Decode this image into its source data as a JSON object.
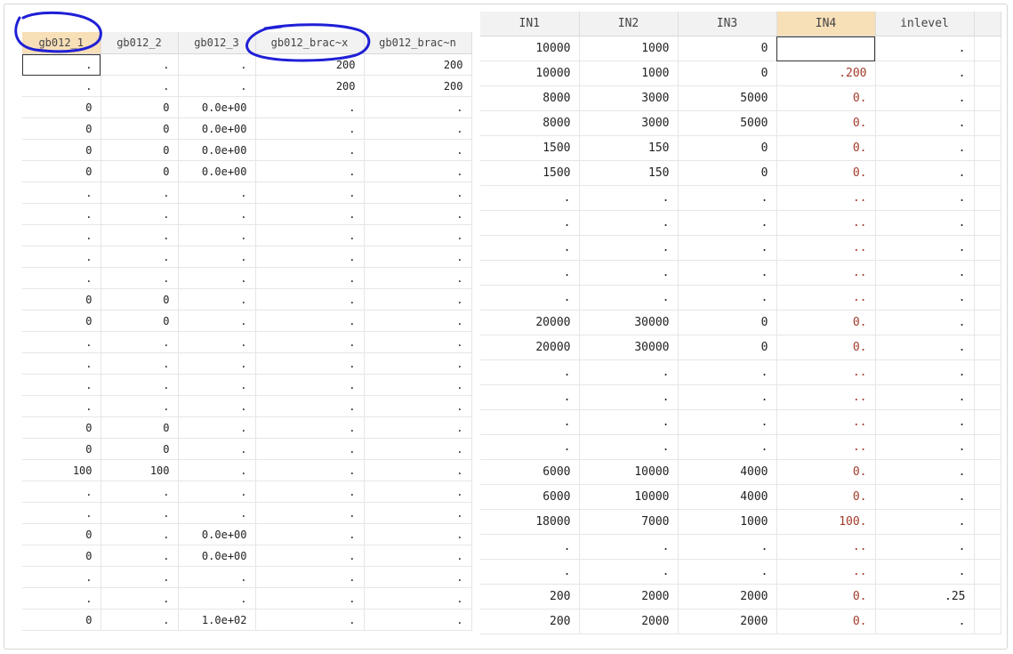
{
  "left_table": {
    "columns": [
      "gb012_1",
      "gb012_2",
      "gb012_3",
      "gb012_brac~x",
      "gb012_brac~n"
    ],
    "selected_column": 0,
    "rows": [
      [
        ".",
        ".",
        ".",
        "200",
        "200"
      ],
      [
        ".",
        ".",
        ".",
        "200",
        "200"
      ],
      [
        "0",
        "0",
        "0.0e+00",
        ".",
        "."
      ],
      [
        "0",
        "0",
        "0.0e+00",
        ".",
        "."
      ],
      [
        "0",
        "0",
        "0.0e+00",
        ".",
        "."
      ],
      [
        "0",
        "0",
        "0.0e+00",
        ".",
        "."
      ],
      [
        ".",
        ".",
        ".",
        ".",
        "."
      ],
      [
        ".",
        ".",
        ".",
        ".",
        "."
      ],
      [
        ".",
        ".",
        ".",
        ".",
        "."
      ],
      [
        ".",
        ".",
        ".",
        ".",
        "."
      ],
      [
        ".",
        ".",
        ".",
        ".",
        "."
      ],
      [
        "0",
        "0",
        ".",
        ".",
        "."
      ],
      [
        "0",
        "0",
        ".",
        ".",
        "."
      ],
      [
        ".",
        ".",
        ".",
        ".",
        "."
      ],
      [
        ".",
        ".",
        ".",
        ".",
        "."
      ],
      [
        ".",
        ".",
        ".",
        ".",
        "."
      ],
      [
        ".",
        ".",
        ".",
        ".",
        "."
      ],
      [
        "0",
        "0",
        ".",
        ".",
        "."
      ],
      [
        "0",
        "0",
        ".",
        ".",
        "."
      ],
      [
        "100",
        "100",
        ".",
        ".",
        "."
      ],
      [
        ".",
        ".",
        ".",
        ".",
        "."
      ],
      [
        ".",
        ".",
        ".",
        ".",
        "."
      ],
      [
        "0",
        ".",
        "0.0e+00",
        ".",
        "."
      ],
      [
        "0",
        ".",
        "0.0e+00",
        ".",
        "."
      ],
      [
        ".",
        ".",
        ".",
        ".",
        "."
      ],
      [
        ".",
        ".",
        ".",
        ".",
        "."
      ],
      [
        "0",
        ".",
        "1.0e+02",
        ".",
        "."
      ]
    ]
  },
  "right_table": {
    "columns": [
      "IN1",
      "IN2",
      "IN3",
      "IN4",
      "inlevel"
    ],
    "selected_column": 3,
    "rows": [
      [
        "10000",
        "1000",
        "0",
        "",
        "."
      ],
      [
        "10000",
        "1000",
        "0",
        ".200",
        "."
      ],
      [
        "8000",
        "3000",
        "5000",
        "0.",
        "."
      ],
      [
        "8000",
        "3000",
        "5000",
        "0.",
        "."
      ],
      [
        "1500",
        "150",
        "0",
        "0.",
        "."
      ],
      [
        "1500",
        "150",
        "0",
        "0.",
        "."
      ],
      [
        ".",
        ".",
        ".",
        "..",
        "."
      ],
      [
        ".",
        ".",
        ".",
        "..",
        "."
      ],
      [
        ".",
        ".",
        ".",
        "..",
        "."
      ],
      [
        ".",
        ".",
        ".",
        "..",
        "."
      ],
      [
        ".",
        ".",
        ".",
        "..",
        "."
      ],
      [
        "20000",
        "30000",
        "0",
        "0.",
        "."
      ],
      [
        "20000",
        "30000",
        "0",
        "0.",
        "."
      ],
      [
        ".",
        ".",
        ".",
        "..",
        "."
      ],
      [
        ".",
        ".",
        ".",
        "..",
        "."
      ],
      [
        ".",
        ".",
        ".",
        "..",
        "."
      ],
      [
        ".",
        ".",
        ".",
        "..",
        "."
      ],
      [
        "6000",
        "10000",
        "4000",
        "0.",
        "."
      ],
      [
        "6000",
        "10000",
        "4000",
        "0.",
        "."
      ],
      [
        "18000",
        "7000",
        "1000",
        "100.",
        "."
      ],
      [
        ".",
        ".",
        ".",
        "..",
        "."
      ],
      [
        ".",
        ".",
        ".",
        "..",
        "."
      ],
      [
        "200",
        "2000",
        "2000",
        "0.",
        ".25"
      ],
      [
        "200",
        "2000",
        "2000",
        "0.",
        "."
      ]
    ]
  },
  "colors": {
    "header_bg": "#f2f2f2",
    "selected_header_bg": "#f7dfb8",
    "in4_text": "#a23a2a",
    "annotation_ink": "#1f1fd6"
  }
}
